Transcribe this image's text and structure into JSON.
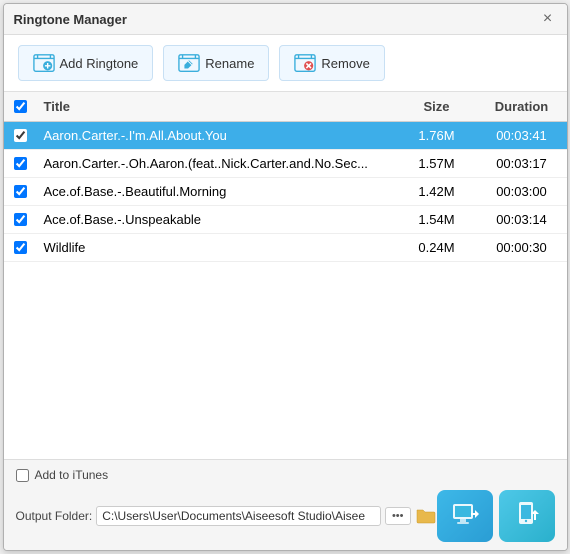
{
  "window": {
    "title": "Ringtone Manager",
    "close_label": "×"
  },
  "toolbar": {
    "add_ringtone_label": "Add Ringtone",
    "rename_label": "Rename",
    "remove_label": "Remove"
  },
  "table": {
    "header": {
      "title": "Title",
      "size": "Size",
      "duration": "Duration"
    },
    "rows": [
      {
        "checked": true,
        "title": "Aaron.Carter.-.I'm.All.About.You",
        "size": "1.76M",
        "duration": "00:03:41",
        "selected": true
      },
      {
        "checked": true,
        "title": "Aaron.Carter.-.Oh.Aaron.(feat..Nick.Carter.and.No.Sec...",
        "size": "1.57M",
        "duration": "00:03:17",
        "selected": false
      },
      {
        "checked": true,
        "title": "Ace.of.Base.-.Beautiful.Morning",
        "size": "1.42M",
        "duration": "00:03:00",
        "selected": false
      },
      {
        "checked": true,
        "title": "Ace.of.Base.-.Unspeakable",
        "size": "1.54M",
        "duration": "00:03:14",
        "selected": false
      },
      {
        "checked": true,
        "title": "Wildlife",
        "size": "0.24M",
        "duration": "00:00:30",
        "selected": false
      }
    ]
  },
  "footer": {
    "itunes_label": "Add to iTunes",
    "output_label": "Output Folder:",
    "output_path": "C:\\Users\\User\\Documents\\Aiseesoft Studio\\Aisee",
    "dots_label": "•••",
    "transfer_tooltip": "Transfer to Device",
    "export_tooltip": "Export"
  },
  "colors": {
    "selected_row_bg": "#3daee9",
    "btn_bg": "#3ab8e0",
    "accent": "#2aa8d8"
  }
}
